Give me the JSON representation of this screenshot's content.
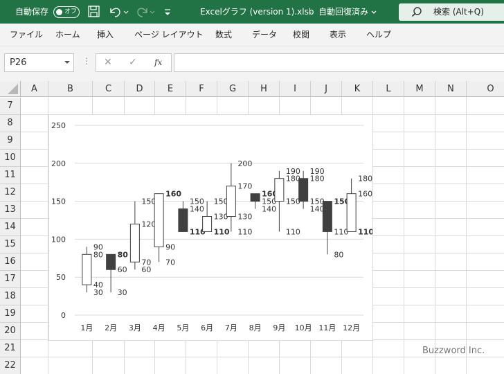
{
  "titlebar": {
    "autosave_label": "自動保存",
    "autosave_state": "オフ",
    "file_title": "Excelグラフ (version 1).xlsb",
    "separator": "-",
    "save_status": "自動回復済み",
    "search_label": "検索 (Alt+Q)"
  },
  "ribbon": {
    "tabs": [
      "ファイル",
      "ホーム",
      "挿入",
      "ページ レイアウト",
      "数式",
      "データ",
      "校閲",
      "表示",
      "ヘルプ"
    ]
  },
  "formula_bar": {
    "name_box": "P26",
    "fx_label": "fx",
    "formula": ""
  },
  "sheet": {
    "columns": [
      "A",
      "B",
      "C",
      "D",
      "E",
      "F",
      "G",
      "H",
      "I",
      "J",
      "K",
      "L",
      "M",
      "N",
      "O"
    ],
    "rows": [
      "7",
      "8",
      "9",
      "10",
      "11",
      "12",
      "13",
      "14",
      "15",
      "16",
      "17",
      "18",
      "19",
      "20",
      "21",
      "22"
    ]
  },
  "chart_data": {
    "type": "candlestick",
    "title": "",
    "xlabel": "",
    "ylabel": "",
    "ylim": [
      0,
      250
    ],
    "yticks": [
      0,
      50,
      100,
      150,
      200,
      250
    ],
    "categories": [
      "1月",
      "2月",
      "3月",
      "4月",
      "5月",
      "6月",
      "7月",
      "8月",
      "9月",
      "10月",
      "11月",
      "12月"
    ],
    "open": [
      40,
      80,
      70,
      90,
      140,
      110,
      130,
      160,
      150,
      180,
      150,
      110
    ],
    "high": [
      90,
      80,
      150,
      160,
      150,
      150,
      200,
      160,
      190,
      190,
      150,
      180
    ],
    "low": [
      30,
      30,
      60,
      70,
      110,
      110,
      110,
      140,
      110,
      140,
      80,
      110
    ],
    "close": [
      80,
      60,
      120,
      160,
      110,
      130,
      170,
      150,
      180,
      150,
      110,
      160
    ],
    "up_color": "#ffffff",
    "down_color": "#404040",
    "grid": true,
    "legend": "none"
  },
  "watermark": "Buzzword Inc."
}
